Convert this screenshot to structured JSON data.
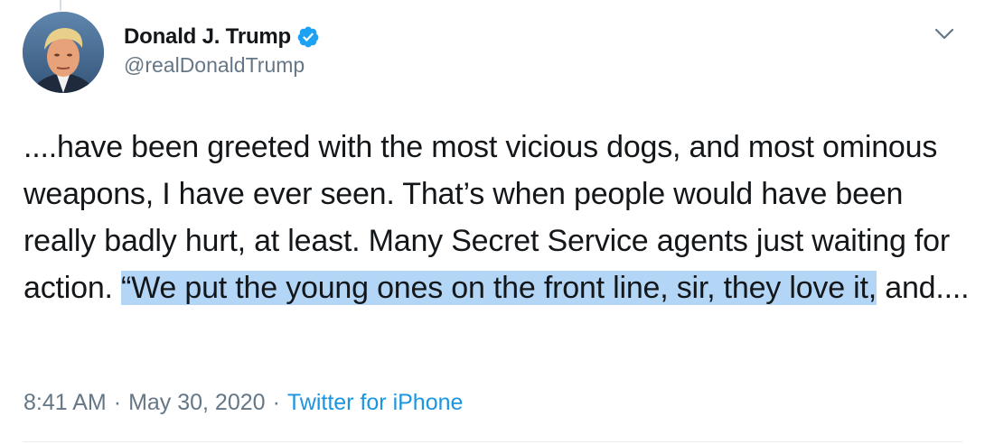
{
  "author": {
    "display_name": "Donald J. Trump",
    "handle": "@realDonaldTrump",
    "verified": true,
    "avatar_icon": "profile-photo",
    "verified_icon": "verified-badge-icon"
  },
  "tweet": {
    "text_before_highlight": "....have been greeted with the most vicious dogs, and most ominous weapons, I have ever seen. That’s when people would have been really badly hurt, at least. Many Secret Service agents just waiting for action. ",
    "text_highlight": "“We put the young ones on the front line, sir, they love it,",
    "text_after_highlight": " and....",
    "highlight_color": "#b3d5f6"
  },
  "meta": {
    "time": "8:41 AM",
    "separator": "·",
    "date": "May 30, 2020",
    "source": "Twitter for iPhone"
  },
  "colors": {
    "text": "#14171a",
    "secondary": "#657786",
    "link": "#1b95e0",
    "verified": "#1da1f2"
  },
  "icons": {
    "menu": "chevron-down-icon"
  }
}
